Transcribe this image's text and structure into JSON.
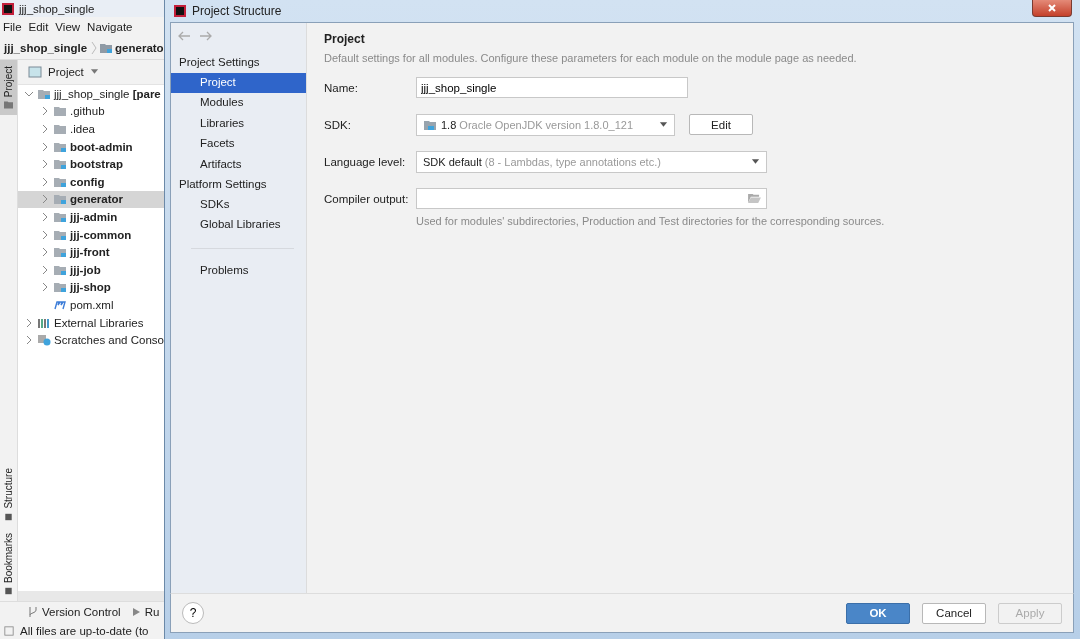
{
  "ide": {
    "title": "jjj_shop_single",
    "menu": [
      "File",
      "Edit",
      "View",
      "Navigate"
    ],
    "breadcrumb": [
      {
        "label": "jjj_shop_single",
        "kind": "project"
      },
      {
        "label": "generato",
        "kind": "module"
      }
    ],
    "side_tabs_top": [
      {
        "label": "Project",
        "selected": true
      }
    ],
    "side_tabs_bottom": [
      {
        "label": "Structure",
        "selected": false
      },
      {
        "label": "Bookmarks",
        "selected": false
      }
    ],
    "panel_title": "Project",
    "tree": [
      {
        "label": "jjj_shop_single **[pare**",
        "kind": "module",
        "bold": false,
        "selected": false,
        "expanded": true,
        "children": [
          {
            "label": ".github",
            "kind": "folder",
            "bold": false,
            "selected": false,
            "expanded": false
          },
          {
            "label": ".idea",
            "kind": "folder",
            "bold": false,
            "selected": false,
            "expanded": false
          },
          {
            "label": "boot-admin",
            "kind": "module",
            "bold": true,
            "selected": false,
            "expanded": false
          },
          {
            "label": "bootstrap",
            "kind": "module",
            "bold": true,
            "selected": false,
            "expanded": false
          },
          {
            "label": "config",
            "kind": "module",
            "bold": true,
            "selected": false,
            "expanded": false
          },
          {
            "label": "generator",
            "kind": "module",
            "bold": true,
            "selected": true,
            "expanded": false
          },
          {
            "label": "jjj-admin",
            "kind": "module",
            "bold": true,
            "selected": false,
            "expanded": false
          },
          {
            "label": "jjj-common",
            "kind": "module",
            "bold": true,
            "selected": false,
            "expanded": false
          },
          {
            "label": "jjj-front",
            "kind": "module",
            "bold": true,
            "selected": false,
            "expanded": false
          },
          {
            "label": "jjj-job",
            "kind": "module",
            "bold": true,
            "selected": false,
            "expanded": false
          },
          {
            "label": "jjj-shop",
            "kind": "module",
            "bold": true,
            "selected": false,
            "expanded": false
          },
          {
            "label": "pom.xml",
            "kind": "maven",
            "bold": false,
            "selected": false
          }
        ]
      },
      {
        "label": "External Libraries",
        "kind": "library",
        "bold": false,
        "selected": false,
        "expanded": false
      },
      {
        "label": "Scratches and Conso",
        "kind": "scratches",
        "bold": false,
        "selected": false,
        "expanded": false
      }
    ],
    "bottom_tabs": [
      {
        "label": "Version Control",
        "kind": "vcs"
      },
      {
        "label": "Ru",
        "kind": "run"
      }
    ],
    "status": "All files are up-to-date (to"
  },
  "dialog": {
    "title": "Project Structure",
    "nav": [
      {
        "heading": "Project Settings",
        "items": [
          {
            "label": "Project",
            "selected": true
          },
          {
            "label": "Modules",
            "selected": false
          },
          {
            "label": "Libraries",
            "selected": false
          },
          {
            "label": "Facets",
            "selected": false
          },
          {
            "label": "Artifacts",
            "selected": false
          }
        ]
      },
      {
        "heading": "Platform Settings",
        "items": [
          {
            "label": "SDKs",
            "selected": false
          },
          {
            "label": "Global Libraries",
            "selected": false
          }
        ]
      }
    ],
    "problems": "Problems",
    "heading": "Project",
    "description": "Default settings for all modules. Configure these parameters for each module on the module page as needed.",
    "name": {
      "label": "Name:",
      "value": "jjj_shop_single"
    },
    "sdk": {
      "label": "SDK:",
      "value": "**1.8** Oracle OpenJDK version 1.8.0_121",
      "edit": "Edit"
    },
    "language_level": {
      "label": "Language level:",
      "value": "**SDK default** (8 - Lambdas, type annotations etc.)"
    },
    "compiler_output": {
      "label": "Compiler output:",
      "hint": "Used for modules' subdirectories, Production and Test directories for the corresponding sources."
    },
    "help": "?",
    "buttons": [
      {
        "label": "OK",
        "kind": "primary",
        "disabled": false
      },
      {
        "label": "Cancel",
        "kind": "normal",
        "disabled": false
      },
      {
        "label": "Apply",
        "kind": "normal",
        "disabled": true
      }
    ]
  }
}
